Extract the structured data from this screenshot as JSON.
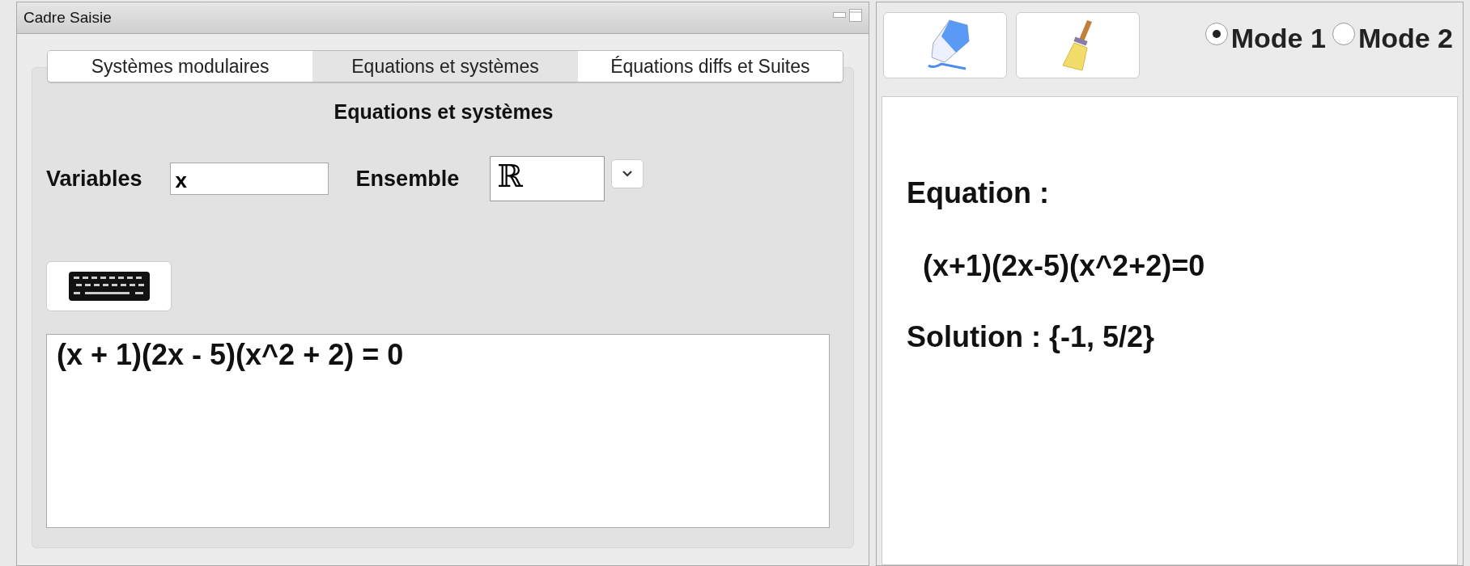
{
  "input_window": {
    "title": "Cadre Saisie",
    "tabs": [
      {
        "label": "Systèmes  modulaires",
        "selected": false
      },
      {
        "label": "Equations et systèmes",
        "selected": true
      },
      {
        "label": "Équations diffs et Suites",
        "selected": false
      }
    ],
    "heading": "Equations et systèmes",
    "variables": {
      "label": "Variables",
      "value": "x"
    },
    "ensemble": {
      "label": "Ensemble",
      "value": "ℝ"
    },
    "editor": {
      "value": "(x + 1)(2x - 5)(x^2 + 2) = 0"
    }
  },
  "output_panel": {
    "modes": [
      {
        "label": "Mode 1",
        "selected": true
      },
      {
        "label": "Mode 2",
        "selected": false
      }
    ],
    "equation_label": "Equation :",
    "equation": "(x+1)(2x-5)(x^2+2)=0",
    "solution": "Solution : {-1, 5/2}"
  }
}
